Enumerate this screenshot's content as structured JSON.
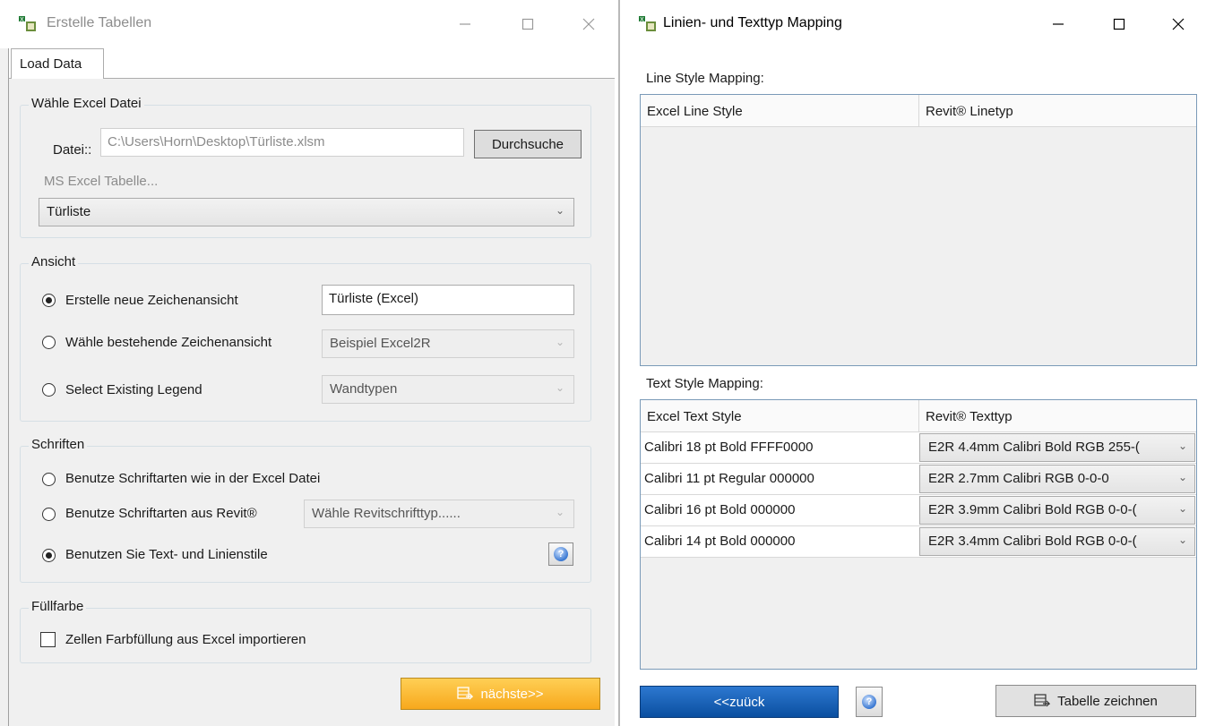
{
  "left": {
    "title": "Erstelle Tabellen",
    "tab_label": "Load Data",
    "excel_group": {
      "label": "Wähle Excel Datei",
      "file_label": "Datei::",
      "file_value": "C:\\Users\\Horn\\Desktop\\Türliste.xlsm",
      "browse_label": "Durchsuche",
      "sheet_label": "MS Excel Tabelle...",
      "sheet_value": "Türliste"
    },
    "view_group": {
      "label": "Ansicht",
      "opt_new": "Erstelle neue Zeichenansicht",
      "new_value": "Türliste (Excel)",
      "opt_existing": "Wähle bestehende Zeichenansicht",
      "existing_value": "Beispiel Excel2R",
      "opt_legend": "Select Existing Legend",
      "legend_value": "Wandtypen"
    },
    "font_group": {
      "label": "Schriften",
      "opt_excel": "Benutze Schriftarten wie in der Excel Datei",
      "opt_revit": "Benutze Schriftarten aus Revit®",
      "revit_placeholder": "Wähle Revitschrifttyp......",
      "opt_styles": "Benutzen Sie Text- und Linienstile"
    },
    "fill_group": {
      "label": "Füllfarbe",
      "opt_fill": "Zellen Farbfüllung aus Excel importieren"
    },
    "next_label": "nächste>>"
  },
  "right": {
    "title": "Linien- und Texttyp Mapping",
    "line_mapping_label": "Line Style Mapping:",
    "line_headers": [
      "Excel Line Style",
      "Revit® Linetyp"
    ],
    "text_mapping_label": "Text Style Mapping:",
    "text_headers": [
      "Excel Text Style",
      "Revit® Texttyp"
    ],
    "text_rows": [
      {
        "excel": "Calibri  18 pt  Bold FFFF0000",
        "revit": "E2R 4.4mm Calibri Bold RGB 255-("
      },
      {
        "excel": "Calibri  11 pt  Regular 000000",
        "revit": "E2R 2.7mm Calibri RGB 0-0-0"
      },
      {
        "excel": "Calibri  16 pt  Bold 000000",
        "revit": "E2R 3.9mm Calibri Bold RGB 0-0-("
      },
      {
        "excel": "Calibri  14 pt  Bold 000000",
        "revit": "E2R 3.4mm Calibri Bold RGB 0-0-("
      }
    ],
    "back_label": "<<zuück",
    "draw_label": "Tabelle zeichnen"
  },
  "colors": {
    "next_button": "#f7a81c",
    "back_button": "#0b4fa0",
    "grid_border": "#7a9ab8"
  },
  "icons": {
    "app": "app-logo-icon",
    "minimize": "minimize-icon",
    "maximize": "maximize-icon",
    "close": "close-icon",
    "help": "help-icon",
    "table": "table-icon",
    "dropdown": "chevron-down-icon"
  }
}
